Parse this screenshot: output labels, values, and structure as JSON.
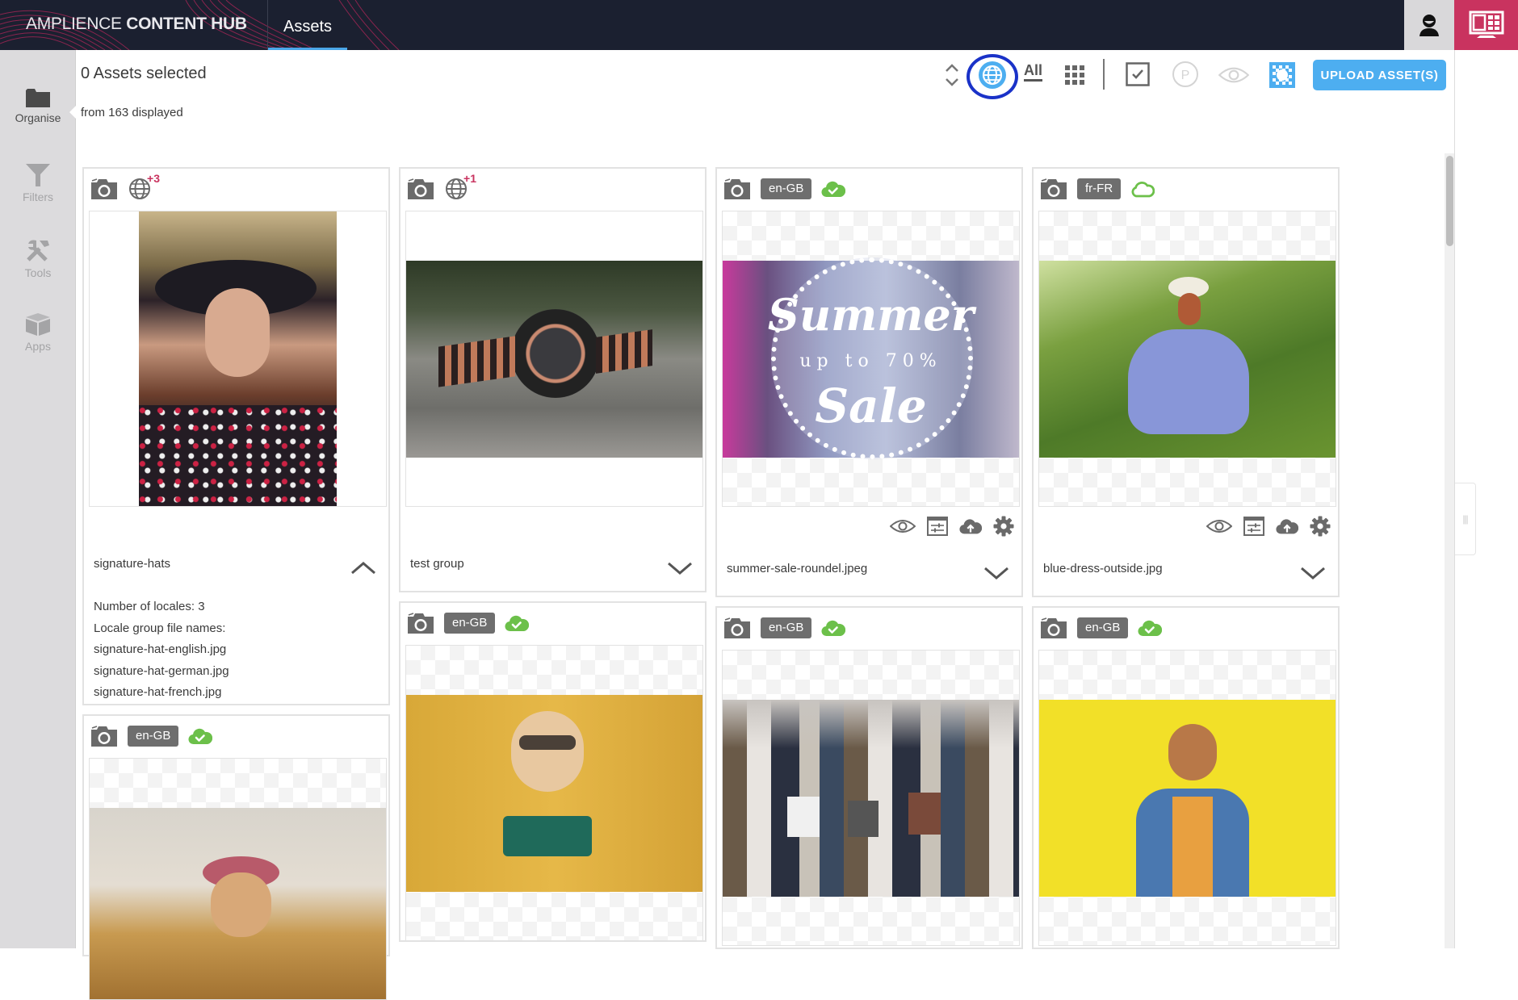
{
  "app": {
    "brand_light": "AMPLIENCE",
    "brand_bold": "CONTENT HUB",
    "active_tab": "Assets"
  },
  "colors": {
    "topbar": "#1b2030",
    "accent_pink": "#c9335f",
    "accent_blue": "#4daef0",
    "status_green": "#6cc04a",
    "highlight_ring": "#1a32c8"
  },
  "sidebar": {
    "items": [
      {
        "label": "Organise",
        "icon": "folder-icon",
        "active": true
      },
      {
        "label": "Filters",
        "icon": "filter-icon",
        "active": false
      },
      {
        "label": "Tools",
        "icon": "tools-icon",
        "active": false
      },
      {
        "label": "Apps",
        "icon": "box-icon",
        "active": false
      }
    ]
  },
  "header": {
    "selected": "0 Assets selected",
    "displayed": "from 163 displayed"
  },
  "toolbar": {
    "sort_icon": "sort-updown-icon",
    "locale_icon": "globe-icon",
    "all_label": "All",
    "grid_icon": "grid-icon",
    "select_icon": "checkbox-icon",
    "publish_icon": "publish-p-icon",
    "preview_icon": "eye-icon",
    "transparency_icon": "checkerboard-icon",
    "upload_label": "UPLOAD ASSET(S)"
  },
  "cards": [
    {
      "type": "group",
      "name": "signature-hats",
      "locale_count": "3",
      "expanded": true,
      "details": {
        "locales": "Number of locales: 3",
        "file_names_label": "Locale group file names:",
        "files": [
          "signature-hat-english.jpg",
          "signature-hat-german.jpg",
          "signature-hat-french.jpg"
        ]
      }
    },
    {
      "type": "group",
      "name": "test group",
      "locale_count": "1",
      "expanded": false
    },
    {
      "type": "asset",
      "name": "summer-sale-roundel.jpeg",
      "locale": "en-GB",
      "status": "published"
    },
    {
      "type": "asset",
      "name": "blue-dress-outside.jpg",
      "locale": "fr-FR",
      "status": "unpublished"
    },
    {
      "type": "asset",
      "name": "",
      "locale": "en-GB",
      "status": "published"
    },
    {
      "type": "asset",
      "name": "",
      "locale": "en-GB",
      "status": "published"
    },
    {
      "type": "asset",
      "name": "",
      "locale": "en-GB",
      "status": "published"
    },
    {
      "type": "asset",
      "name": "",
      "locale": "en-GB",
      "status": "published"
    }
  ],
  "summer_sale_text": {
    "line1": "Summer",
    "line2": "up to 70%",
    "line3": "Sale"
  },
  "card_actions": [
    "eye-icon",
    "adjust-icon",
    "cloud-upload-icon",
    "gear-icon"
  ]
}
